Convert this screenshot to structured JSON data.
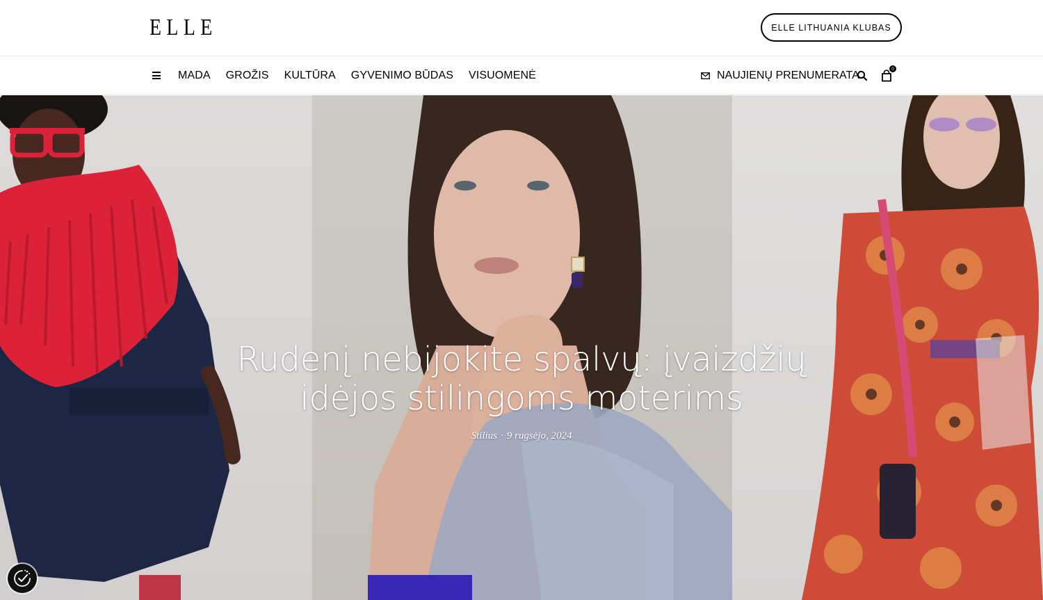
{
  "header": {
    "logo_text": "ELLE",
    "club_button_label": "ELLE LITHUANIA KLUBAS"
  },
  "nav": {
    "menu_icon": "hamburger-icon",
    "items": [
      {
        "label": "MADA"
      },
      {
        "label": "GROŽIS"
      },
      {
        "label": "KULTŪRA"
      },
      {
        "label": "GYVENIMO BŪDAS"
      },
      {
        "label": "VISUOMENĖ"
      }
    ],
    "subscribe_label": "NAUJIENŲ PRENUMERATA",
    "subscribe_icon": "envelope-icon",
    "search_icon": "search-icon",
    "cart_icon": "shopping-bag-icon",
    "cart_count": "0"
  },
  "hero": {
    "title": "Rudenį nebijokite spalvų: įvaizdžių idėjos stilingoms moterims",
    "category": "Stilius",
    "separator": "·",
    "date": "9 rugsėjo, 2024"
  },
  "cookie": {
    "icon": "cookie-consent-icon"
  },
  "colors": {
    "text": "#000000",
    "hero_text": "#ffffff",
    "accent_red": "#e8243c",
    "navy": "#1f2a48",
    "floral_red": "#d9503a"
  }
}
